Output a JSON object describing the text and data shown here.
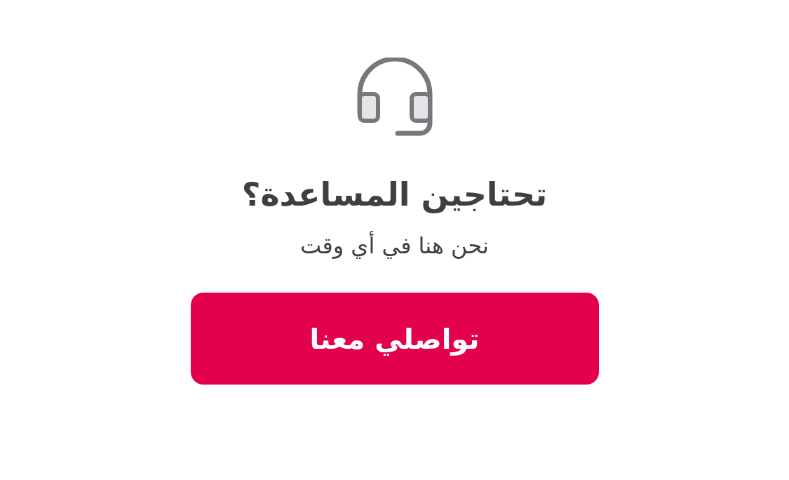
{
  "title": "تحتاجين المساعدة؟",
  "subtitle": "نحن هنا في أي وقت",
  "button": {
    "label": "تواصلي معنا"
  }
}
